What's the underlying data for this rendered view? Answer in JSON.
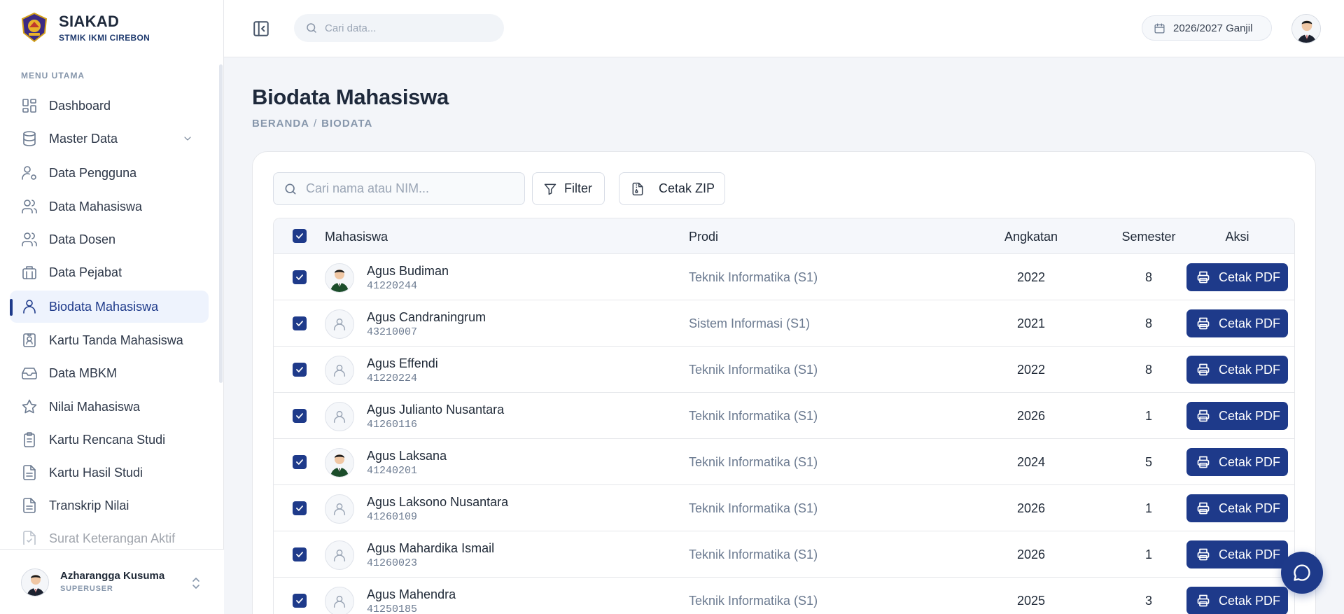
{
  "brand": {
    "title": "SIAKAD",
    "subtitle": "STMIK IKMI CIREBON"
  },
  "sidebar": {
    "heading": "MENU UTAMA",
    "items": [
      {
        "label": "Dashboard",
        "icon": "dashboard-icon"
      },
      {
        "label": "Master Data",
        "icon": "database-icon"
      },
      {
        "label": "Data Pengguna",
        "icon": "user-cog-icon"
      },
      {
        "label": "Data Mahasiswa",
        "icon": "users-icon"
      },
      {
        "label": "Data Dosen",
        "icon": "users-icon"
      },
      {
        "label": "Data Pejabat",
        "icon": "building-icon"
      },
      {
        "label": "Biodata Mahasiswa",
        "icon": "user-icon",
        "active": true
      },
      {
        "label": "Kartu Tanda Mahasiswa",
        "icon": "id-card-icon"
      },
      {
        "label": "Data MBKM",
        "icon": "inbox-icon"
      },
      {
        "label": "Nilai Mahasiswa",
        "icon": "star-icon"
      },
      {
        "label": "Kartu Rencana Studi",
        "icon": "clipboard-icon"
      },
      {
        "label": "Kartu Hasil Studi",
        "icon": "file-text-icon"
      },
      {
        "label": "Transkrip Nilai",
        "icon": "file-text-icon"
      },
      {
        "label": "Surat Keterangan Aktif",
        "icon": "file-check-icon"
      }
    ]
  },
  "user": {
    "name": "Azharangga Kusuma",
    "role": "SUPERUSER"
  },
  "topbar": {
    "search_placeholder": "Cari data...",
    "academic_year": "2026/2027 Ganjil"
  },
  "page": {
    "title": "Biodata Mahasiswa",
    "breadcrumb": [
      "BERANDA",
      "BIODATA"
    ]
  },
  "toolbar": {
    "search_placeholder": "Cari nama atau NIM...",
    "filter_label": "Filter",
    "zip_label": "Cetak ZIP"
  },
  "table": {
    "headers": {
      "student": "Mahasiswa",
      "prodi": "Prodi",
      "angkatan": "Angkatan",
      "semester": "Semester",
      "aksi": "Aksi"
    },
    "action_label": "Cetak PDF",
    "rows": [
      {
        "name": "Agus Budiman",
        "nim": "41220244",
        "prodi": "Teknik Informatika (S1)",
        "angkatan": "2022",
        "semester": "8",
        "photo": true
      },
      {
        "name": "Agus Candraningrum",
        "nim": "43210007",
        "prodi": "Sistem Informasi (S1)",
        "angkatan": "2021",
        "semester": "8",
        "photo": false
      },
      {
        "name": "Agus Effendi",
        "nim": "41220224",
        "prodi": "Teknik Informatika (S1)",
        "angkatan": "2022",
        "semester": "8",
        "photo": false
      },
      {
        "name": "Agus Julianto Nusantara",
        "nim": "41260116",
        "prodi": "Teknik Informatika (S1)",
        "angkatan": "2026",
        "semester": "1",
        "photo": false
      },
      {
        "name": "Agus Laksana",
        "nim": "41240201",
        "prodi": "Teknik Informatika (S1)",
        "angkatan": "2024",
        "semester": "5",
        "photo": true
      },
      {
        "name": "Agus Laksono Nusantara",
        "nim": "41260109",
        "prodi": "Teknik Informatika (S1)",
        "angkatan": "2026",
        "semester": "1",
        "photo": false
      },
      {
        "name": "Agus Mahardika Ismail",
        "nim": "41260023",
        "prodi": "Teknik Informatika (S1)",
        "angkatan": "2026",
        "semester": "1",
        "photo": false
      },
      {
        "name": "Agus Mahendra",
        "nim": "41250185",
        "prodi": "Teknik Informatika (S1)",
        "angkatan": "2025",
        "semester": "3",
        "photo": false
      }
    ]
  },
  "colors": {
    "primary": "#1e3a8a",
    "muted": "#6b7a90",
    "background": "#f3f5f9"
  }
}
